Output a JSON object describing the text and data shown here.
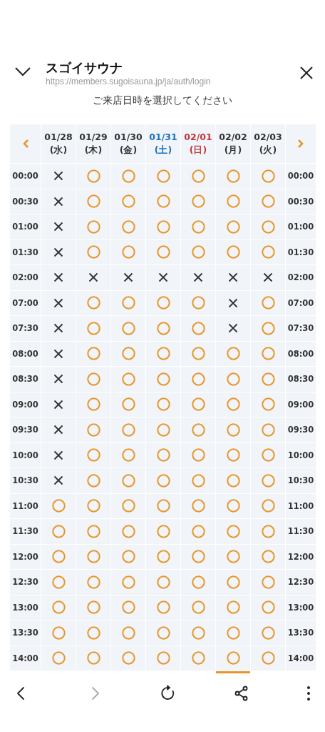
{
  "header": {
    "title": "スゴイサウナ",
    "url": "https://members.sugoisauna.jp/ja/auth/login"
  },
  "prompt": "ご来店日時を選択してください",
  "days": [
    {
      "date": "01/28",
      "weekday": "(水)",
      "kind": "weekday",
      "selected": false
    },
    {
      "date": "01/29",
      "weekday": "(木)",
      "kind": "weekday",
      "selected": false
    },
    {
      "date": "01/30",
      "weekday": "(金)",
      "kind": "weekday",
      "selected": false
    },
    {
      "date": "01/31",
      "weekday": "(土)",
      "kind": "saturday",
      "selected": false
    },
    {
      "date": "02/01",
      "weekday": "(日)",
      "kind": "sunday",
      "selected": false
    },
    {
      "date": "02/02",
      "weekday": "(月)",
      "kind": "weekday",
      "selected": true
    },
    {
      "date": "02/03",
      "weekday": "(火)",
      "kind": "weekday",
      "selected": false
    }
  ],
  "rows": [
    {
      "time_left": "00:00",
      "slots": [
        false,
        true,
        true,
        true,
        true,
        true,
        true
      ],
      "time_right": "00:00"
    },
    {
      "time_left": "00:30",
      "slots": [
        false,
        true,
        true,
        true,
        true,
        true,
        true
      ],
      "time_right": "00:30"
    },
    {
      "time_left": "01:00",
      "slots": [
        false,
        true,
        true,
        true,
        true,
        true,
        true
      ],
      "time_right": "01:00"
    },
    {
      "time_left": "01:30",
      "slots": [
        false,
        true,
        true,
        true,
        true,
        true,
        true
      ],
      "time_right": "01:30"
    },
    {
      "time_left": "02:00",
      "slots": [
        false,
        false,
        false,
        false,
        false,
        false,
        false
      ],
      "time_right": "02:00"
    },
    {
      "time_left": "07:00",
      "slots": [
        false,
        true,
        true,
        true,
        true,
        false,
        true
      ],
      "time_right": "07:00"
    },
    {
      "time_left": "07:30",
      "slots": [
        false,
        true,
        true,
        true,
        true,
        false,
        true
      ],
      "time_right": "07:30"
    },
    {
      "time_left": "08:00",
      "slots": [
        false,
        true,
        true,
        true,
        true,
        true,
        true
      ],
      "time_right": "08:00"
    },
    {
      "time_left": "08:30",
      "slots": [
        false,
        true,
        true,
        true,
        true,
        true,
        true
      ],
      "time_right": "08:30"
    },
    {
      "time_left": "09:00",
      "slots": [
        false,
        true,
        true,
        true,
        true,
        true,
        true
      ],
      "time_right": "09:00"
    },
    {
      "time_left": "09:30",
      "slots": [
        false,
        true,
        true,
        true,
        true,
        true,
        true
      ],
      "time_right": "09:30"
    },
    {
      "time_left": "10:00",
      "slots": [
        false,
        true,
        true,
        true,
        true,
        true,
        true
      ],
      "time_right": "10:00"
    },
    {
      "time_left": "10:30",
      "slots": [
        false,
        true,
        true,
        true,
        true,
        true,
        true
      ],
      "time_right": "10:30"
    },
    {
      "time_left": "11:00",
      "slots": [
        true,
        true,
        true,
        true,
        true,
        true,
        true
      ],
      "time_right": "11:00"
    },
    {
      "time_left": "11:30",
      "slots": [
        true,
        true,
        true,
        true,
        true,
        true,
        true
      ],
      "time_right": "11:30"
    },
    {
      "time_left": "12:00",
      "slots": [
        true,
        true,
        true,
        true,
        true,
        true,
        true
      ],
      "time_right": "12:00"
    },
    {
      "time_left": "12:30",
      "slots": [
        true,
        true,
        true,
        true,
        true,
        true,
        true
      ],
      "time_right": "12:30"
    },
    {
      "time_left": "13:00",
      "slots": [
        true,
        true,
        true,
        true,
        true,
        true,
        true
      ],
      "time_right": "13:00"
    },
    {
      "time_left": "13:30",
      "slots": [
        true,
        true,
        true,
        true,
        true,
        true,
        true
      ],
      "time_right": "13:30"
    },
    {
      "time_left": "14:00",
      "slots": [
        true,
        true,
        true,
        true,
        true,
        true,
        true
      ],
      "time_right": "14:00"
    }
  ],
  "toolbar": [
    {
      "kind": "back",
      "disabled": false
    },
    {
      "kind": "forward",
      "disabled": true
    },
    {
      "kind": "reload",
      "disabled": false
    },
    {
      "kind": "share",
      "disabled": false
    },
    {
      "kind": "more",
      "disabled": false
    }
  ]
}
